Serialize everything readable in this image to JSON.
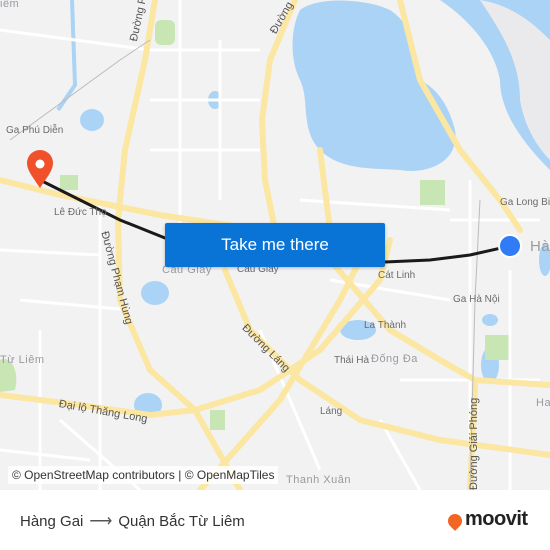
{
  "map": {
    "labels": {
      "pham_van_dong": "Đường Phạm V",
      "duong_top": "Đường",
      "ga_phu_dien": "Ga Phú Diễn",
      "le_duc_tho": "Lê Đức Thọ",
      "pham_hung": "Đường Phạm Hùng",
      "cau_giay_dist": "Cầu Giấy",
      "cau_giay": "Cầu Giấy",
      "cat_linh": "Cát Linh",
      "ga_long_bien": "Ga Long Biên",
      "ha_noi_dist": "Hà",
      "ga_ha_noi": "Ga Hà Nội",
      "la_thanh": "La Thành",
      "thai_ha": "Thái Hà",
      "dong_da": "Đống Đa",
      "duong_lang": "Đường Láng",
      "tu_liem": "Từ Liêm",
      "dai_lo_thang_long": "Đại lộ Thăng Long",
      "lang": "Láng",
      "giai_phong": "Đường Giải Phóng",
      "thanh_xuan": "Thanh Xuân",
      "ha_right": "Ha",
      "tiem": "iêm"
    },
    "origin_marker": "origin-pin",
    "destination_marker": "destination-pin",
    "colors": {
      "route": "#1a1a1a",
      "origin": "#2f7cf6",
      "destination": "#f0512a",
      "water": "#aad3f5",
      "road": "#fbe6a2",
      "park": "#c8e6b4"
    }
  },
  "cta": {
    "label": "Take me there"
  },
  "attribution": "© OpenStreetMap contributors | © OpenMapTiles",
  "footer": {
    "from": "Hàng Gai",
    "arrow": "⟶",
    "to": "Quận Bắc Từ Liêm",
    "brand": "moovit"
  }
}
